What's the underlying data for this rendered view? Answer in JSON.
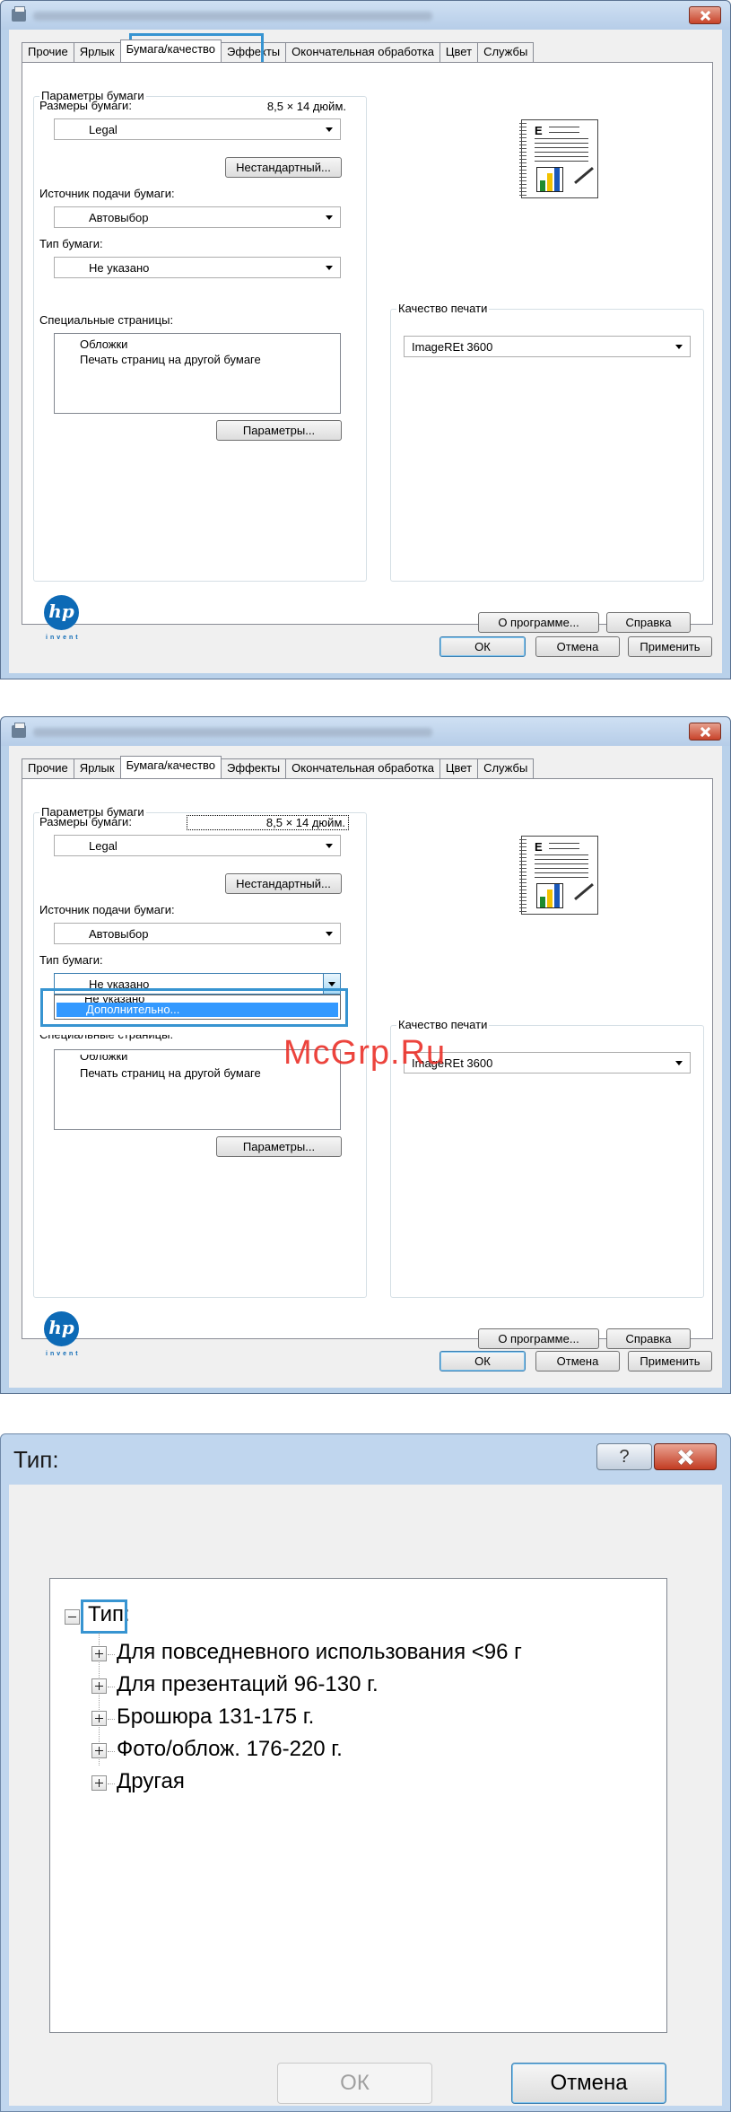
{
  "window_tabs": [
    "Прочие",
    "Ярлык",
    "Бумага/качество",
    "Эффекты",
    "Окончательная обработка",
    "Цвет",
    "Службы"
  ],
  "panel1": {
    "paper_options_title": "Параметры бумаги",
    "paper_sizes_label": "Размеры бумаги:",
    "paper_size_value": "8,5 × 14 дюйм.",
    "paper_size_select": "Legal",
    "custom_button": "Нестандартный...",
    "paper_source_label": "Источник подачи бумаги:",
    "paper_source_value": "Автовыбор",
    "paper_type_label": "Тип бумаги:",
    "paper_type_value": "Не указано",
    "special_pages_label": "Специальные страницы:",
    "special_pages_items": [
      "Обложки",
      "Печать страниц на другой бумаге"
    ],
    "settings_button": "Параметры...",
    "print_quality_title": "Качество печати",
    "print_quality_value": "ImageREt 3600",
    "about_button": "О программе...",
    "help_button": "Справка",
    "ok_button": "ОК",
    "cancel_button": "Отмена",
    "apply_button": "Применить",
    "logo_text": "hp",
    "logo_tagline": "invent"
  },
  "panel2": {
    "dropdown_options": [
      "Не указано",
      "Дополнительно..."
    ],
    "selected_option": "Дополнительно...",
    "special_pages_label_partial": "Специальные страницы:"
  },
  "watermark": "McGrp.Ru",
  "type_dialog": {
    "title": "Тип:",
    "help_button": "?",
    "root_label": "Тип:",
    "children": [
      "Для повседневного использования <96 г",
      "Для презентаций 96-130 г.",
      "Брошюра 131-175 г.",
      "Фото/облож. 176-220 г.",
      "Другая"
    ],
    "ok_button": "ОК",
    "cancel_button": "Отмена"
  },
  "colors": {
    "highlight": "#3794d1",
    "selection": "#3399ff",
    "hp_blue": "#0d6ab6",
    "watermark_red": "#ea3029"
  }
}
